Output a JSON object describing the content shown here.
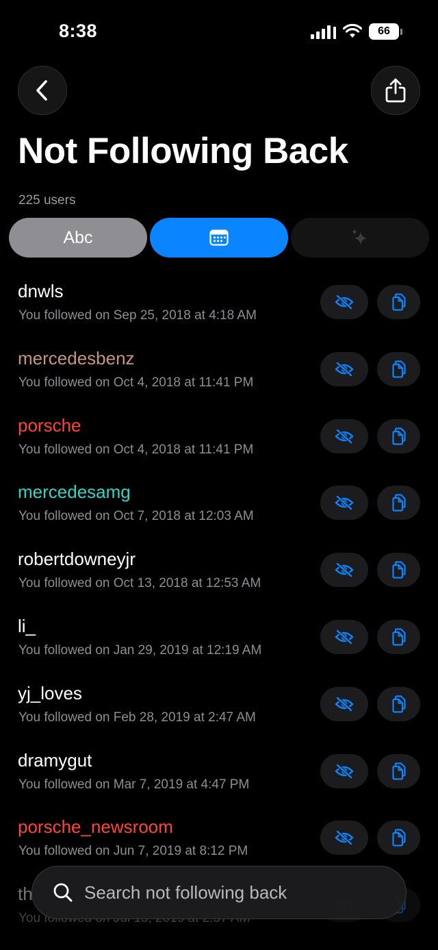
{
  "status_bar": {
    "time": "8:38",
    "battery": "66"
  },
  "header": {
    "title": "Not Following Back",
    "count": "225 users"
  },
  "segments": {
    "abc_label": "Abc",
    "selected": "date"
  },
  "colors": {
    "accent": "#0a84ff",
    "mercedesbenz": "#c8977a",
    "porsche": "#ff453a",
    "mercedesamg": "#30d5c8",
    "default": "#ffffff"
  },
  "users": [
    {
      "name": "dnwls",
      "followed": "You followed on Sep 25, 2018 at 4:18 AM",
      "color": "#ffffff"
    },
    {
      "name": "mercedesbenz",
      "followed": "You followed on Oct 4, 2018 at 11:41 PM",
      "color": "#c8977a"
    },
    {
      "name": "porsche",
      "followed": "You followed on Oct 4, 2018 at 11:41 PM",
      "color": "#ff453a"
    },
    {
      "name": "mercedesamg",
      "followed": "You followed on Oct 7, 2018 at 12:03 AM",
      "color": "#30d5c8"
    },
    {
      "name": "robertdowneyjr",
      "followed": "You followed on Oct 13, 2018 at 12:53 AM",
      "color": "#ffffff"
    },
    {
      "name": "li_",
      "followed": "You followed on Jan 29, 2019 at 12:19 AM",
      "color": "#ffffff"
    },
    {
      "name": "yj_loves",
      "followed": "You followed on Feb 28, 2019 at 2:47 AM",
      "color": "#ffffff"
    },
    {
      "name": "dramygut",
      "followed": "You followed on Mar 7, 2019 at 4:47 PM",
      "color": "#ffffff"
    },
    {
      "name": "porsche_newsroom",
      "followed": "You followed on Jun 7, 2019 at 8:12 PM",
      "color": "#ff453a"
    },
    {
      "name": "th",
      "followed": "You followed on Jul 15, 2019 at 2:57 AM",
      "color": "#ffffff"
    }
  ],
  "icons": {
    "back": "chevron-left-icon",
    "share": "share-icon",
    "calendar": "calendar-icon",
    "sparkle": "sparkles-icon",
    "hide": "eye-slash-icon",
    "copy": "copy-icon",
    "search": "search-icon"
  },
  "search": {
    "placeholder": "Search not following back"
  }
}
